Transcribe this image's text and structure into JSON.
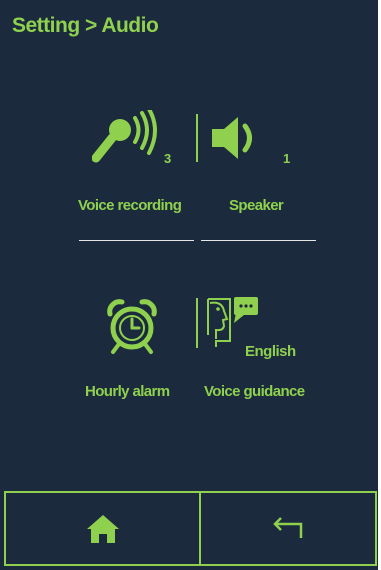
{
  "header": {
    "breadcrumb": "Setting > Audio"
  },
  "audio": {
    "voice_recording": {
      "label": "Voice recording",
      "value": "3",
      "icon": "microphone-icon"
    },
    "speaker": {
      "label": "Speaker",
      "value": "1",
      "icon": "speaker-icon"
    },
    "hourly_alarm": {
      "label": "Hourly alarm",
      "icon": "alarm-clock-icon"
    },
    "voice_guidance": {
      "label": "Voice guidance",
      "value": "English",
      "icon": "voice-guidance-icon"
    }
  },
  "footer": {
    "home": {
      "icon": "home-icon"
    },
    "back": {
      "icon": "back-arrow-icon"
    }
  },
  "colors": {
    "background": "#1b2a3c",
    "accent": "#8fd14f",
    "underline": "#e6e6e6"
  }
}
